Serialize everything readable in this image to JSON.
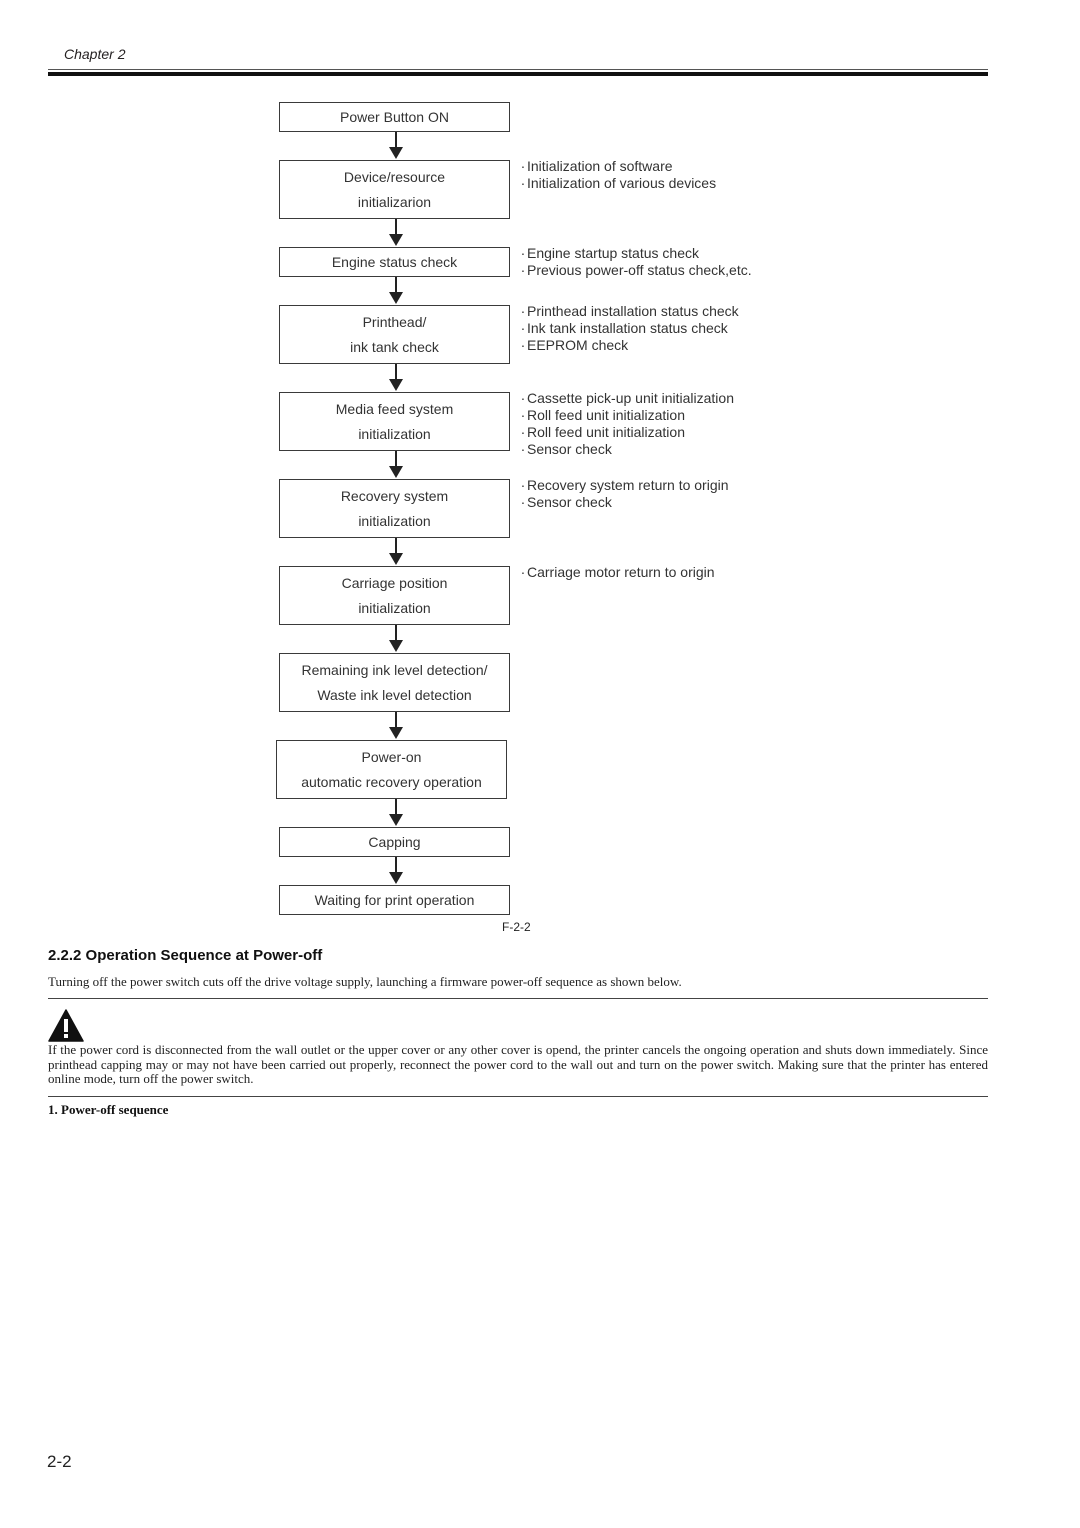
{
  "header": {
    "chapter": "Chapter 2"
  },
  "flowchart": {
    "figure_label": "F-2-2",
    "steps": [
      {
        "lines": [
          "Power Button ON"
        ],
        "notes": []
      },
      {
        "lines": [
          "Device/resource",
          "initializarion"
        ],
        "notes": [
          "Initialization of software",
          "Initialization of various devices"
        ]
      },
      {
        "lines": [
          "Engine status check"
        ],
        "notes": [
          "Engine startup status check",
          "Previous power-off status check,etc."
        ]
      },
      {
        "lines": [
          "Printhead/",
          "ink tank check"
        ],
        "notes": [
          "Printhead installation status check",
          "Ink tank installation status check",
          "EEPROM check"
        ]
      },
      {
        "lines": [
          "Media feed system",
          "initialization"
        ],
        "notes": [
          "Cassette pick-up unit initialization",
          "Roll feed unit initialization",
          "Roll feed unit initialization",
          "Sensor check"
        ]
      },
      {
        "lines": [
          "Recovery system",
          "initialization"
        ],
        "notes": [
          "Recovery system return to origin",
          "Sensor check"
        ]
      },
      {
        "lines": [
          "Carriage position",
          "initialization"
        ],
        "notes": [
          "Carriage motor return to origin"
        ]
      },
      {
        "lines": [
          "Remaining ink level detection/",
          "Waste ink level detection"
        ],
        "notes": []
      },
      {
        "lines": [
          "Power-on",
          "automatic recovery operation"
        ],
        "notes": []
      },
      {
        "lines": [
          "Capping"
        ],
        "notes": []
      },
      {
        "lines": [
          "Waiting for print operation"
        ],
        "notes": []
      }
    ],
    "bullet_glyph": "·"
  },
  "section": {
    "title": "2.2.2 Operation Sequence at Power-off",
    "intro": "Turning off the power switch cuts off the drive voltage supply, launching a firmware power-off sequence as shown below.",
    "warning_icon": "warning-triangle-icon",
    "warning_text": "If the power cord is disconnected from the wall outlet or the upper cover or any other cover is opend, the printer cancels the ongoing operation and shuts down immediately. Since printhead capping may or may not have been carried out properly, reconnect the power cord to the wall out and turn on the power switch. Making sure that the printer has entered online mode, turn off the power switch.",
    "subheading": "1. Power-off sequence"
  },
  "footer": {
    "page_number": "2-2"
  }
}
